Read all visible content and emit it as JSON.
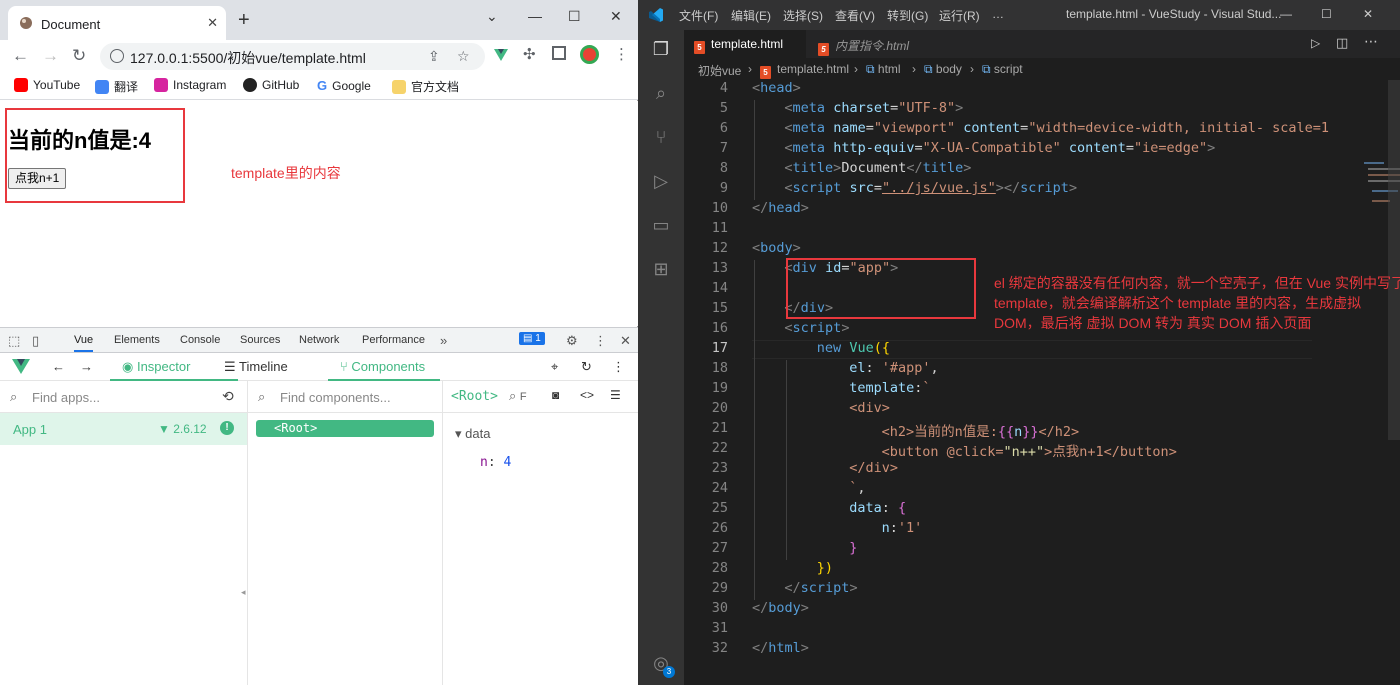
{
  "browser": {
    "tab_title": "Document",
    "url": "127.0.0.1:5500/初始vue/template.html",
    "bookmarks": [
      "YouTube",
      "翻译",
      "Instagram",
      "GitHub",
      "Google",
      "官方文档"
    ],
    "page": {
      "heading": "当前的n值是:4",
      "button_label": "点我n+1",
      "annotation": "template里的内容"
    },
    "devtools": {
      "tabs": [
        "Vue",
        "Elements",
        "Console",
        "Sources",
        "Network",
        "Performance"
      ],
      "badge_count": "1",
      "vue_tabs": [
        "Inspector",
        "Timeline",
        "Components"
      ],
      "find_apps_placeholder": "Find apps...",
      "find_components_placeholder": "Find components...",
      "root_label": "<Root>",
      "app_name": "App 1",
      "vue_version": "2.6.12",
      "root_node": "<Root>",
      "data_section": "data",
      "data_key": "n",
      "data_value": "4"
    }
  },
  "vscode": {
    "menus": [
      "文件(F)",
      "编辑(E)",
      "选择(S)",
      "查看(V)",
      "转到(G)",
      "运行(R)",
      "…"
    ],
    "window_title": "template.html - VueStudy - Visual Stud...",
    "tabs": [
      "template.html",
      "内置指令.html"
    ],
    "breadcrumbs": [
      "初始vue",
      "template.html",
      "html",
      "body",
      "script"
    ],
    "line_numbers": [
      "4",
      "5",
      "6",
      "7",
      "8",
      "9",
      "10",
      "11",
      "12",
      "13",
      "14",
      "15",
      "16",
      "17",
      "18",
      "19",
      "20",
      "21",
      "22",
      "23",
      "24",
      "25",
      "26",
      "27",
      "28",
      "29",
      "30",
      "31",
      "32"
    ],
    "annotation": [
      "el 绑定的容器没有任何内容，就一个空壳子，但在 Vue 实例中写了",
      "template，就会编译解析这个 template 里的内容，生成虚拟",
      "DOM，最后将 虚拟 DOM 转为 真实 DOM 插入页面"
    ],
    "code": {
      "l4": [
        "<",
        "head",
        ">"
      ],
      "l5": [
        "<",
        "meta",
        " ",
        "charset",
        "=",
        "\"UTF-8\"",
        ">"
      ],
      "l6": [
        "<",
        "meta",
        " ",
        "name",
        "=",
        "\"viewport\"",
        " ",
        "content",
        "=",
        "\"width=device-width, initial- scale=1"
      ],
      "l7": [
        "<",
        "meta",
        " ",
        "http-equiv",
        "=",
        "\"X-UA-Compatible\"",
        " ",
        "content",
        "=",
        "\"ie=edge\"",
        ">"
      ],
      "l8": [
        "<",
        "title",
        ">",
        "Document",
        "</",
        "title",
        ">"
      ],
      "l9": [
        "<",
        "script",
        " ",
        "src",
        "=",
        "\"../js/vue.js\"",
        "></",
        "script",
        ">"
      ],
      "l10": [
        "</",
        "head",
        ">"
      ],
      "l12": [
        "<",
        "body",
        ">"
      ],
      "l13": [
        "<",
        "div",
        " ",
        "id",
        "=",
        "\"app\"",
        ">"
      ],
      "l15": [
        "</",
        "div",
        ">"
      ],
      "l16": [
        "<",
        "script",
        ">"
      ],
      "l17": [
        "new",
        " ",
        "Vue",
        "({"
      ],
      "l18": [
        "el",
        ": ",
        "'#app'",
        ","
      ],
      "l19": [
        "template",
        ":",
        "`"
      ],
      "l20": [
        "<div>"
      ],
      "l21": [
        "<h2>当前的n值是:",
        "{{",
        "n",
        "}}",
        "</h2>"
      ],
      "l22": [
        "<button @click=",
        "\"n++\"",
        ">点我n+1</button>"
      ],
      "l23": [
        "</div>"
      ],
      "l24": [
        "`",
        ","
      ],
      "l25": [
        "data",
        ": ",
        "{"
      ],
      "l26": [
        "n",
        ":",
        "'1'"
      ],
      "l27": [
        "}"
      ],
      "l28": [
        "})"
      ],
      "l29": [
        "</",
        "script",
        ">"
      ],
      "l30": [
        "</",
        "body",
        ">"
      ],
      "l32": [
        "</",
        "html",
        ">"
      ]
    },
    "account_badge": "3"
  },
  "colors": {
    "annotation_red": "#e8383d",
    "vue_green": "#42b883",
    "vscode_bg": "#1e1e1e"
  }
}
